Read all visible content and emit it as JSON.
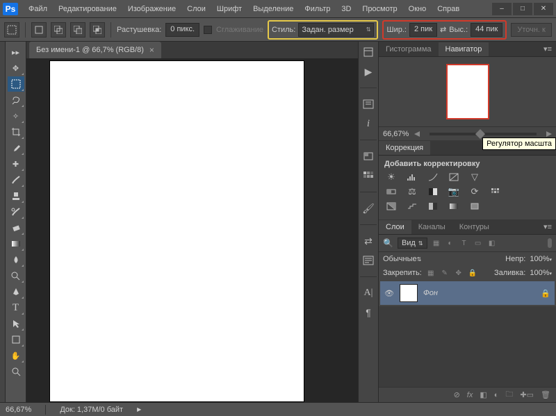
{
  "app": {
    "logo": "Ps"
  },
  "menu": [
    "Файл",
    "Редактирование",
    "Изображение",
    "Слои",
    "Шрифт",
    "Выделение",
    "Фильтр",
    "3D",
    "Просмотр",
    "Окно",
    "Справ"
  ],
  "window_buttons": [
    "–",
    "□",
    "✕"
  ],
  "options": {
    "feather_label": "Растушевка:",
    "feather_value": "0 пикс.",
    "antialias_label": "Сглаживание",
    "style_label": "Стиль:",
    "style_value": "Задан. размер",
    "width_label": "Шир.:",
    "width_value": "2 пик",
    "height_label": "Выс.:",
    "height_value": "44 пик",
    "refine_label": "Уточн. к"
  },
  "document": {
    "tab_title": "Без имени-1 @ 66,7% (RGB/8)",
    "zoom_status": "66,67%",
    "doc_info": "Док: 1,37M/0 байт"
  },
  "panels": {
    "histogram_tab": "Гистограмма",
    "navigator_tab": "Навигатор",
    "nav_zoom": "66,67%",
    "correction_tab": "Коррекция",
    "correction_add": "Добавить корректировку",
    "layers_tab": "Слои",
    "channels_tab": "Каналы",
    "paths_tab": "Контуры",
    "kind_label": "Вид",
    "blend_mode": "Обычные",
    "opacity_label": "Непр:",
    "opacity_value": "100%",
    "lock_label": "Закрепить:",
    "fill_label": "Заливка:",
    "fill_value": "100%",
    "bg_layer": "Фон"
  },
  "tooltip": "Регулятор масшта"
}
